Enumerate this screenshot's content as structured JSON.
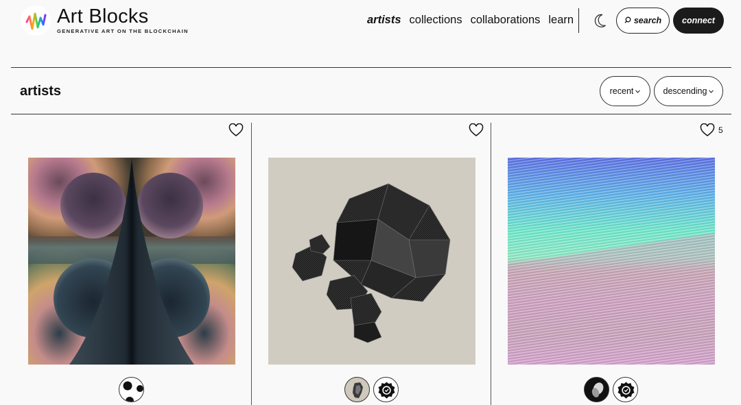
{
  "brand": {
    "title": "Art Blocks",
    "subtitle": "GENERATIVE ART ON THE BLOCKCHAIN",
    "logo_icon": "rainbow-waveform-logo"
  },
  "nav": {
    "items": [
      "artists",
      "collections",
      "collaborations",
      "learn"
    ],
    "active": "artists",
    "theme_icon": "moon-icon",
    "search_label": "search",
    "search_icon": "search-icon",
    "connect_label": "connect"
  },
  "section": {
    "title": "artists",
    "sort_by": "recent",
    "sort_order": "descending",
    "caret_icon": "chevron-down-icon"
  },
  "cards": [
    {
      "favorite_icon": "heart-outline-icon",
      "like_count": ""
    },
    {
      "favorite_icon": "heart-outline-icon",
      "like_count": ""
    },
    {
      "favorite_icon": "heart-outline-icon",
      "like_count": "5"
    }
  ],
  "colors": {
    "background": "#f9f9f9",
    "text": "#111111",
    "connect_bg": "#1b1b1b",
    "artwork2_bg": "#d0ccc1"
  }
}
